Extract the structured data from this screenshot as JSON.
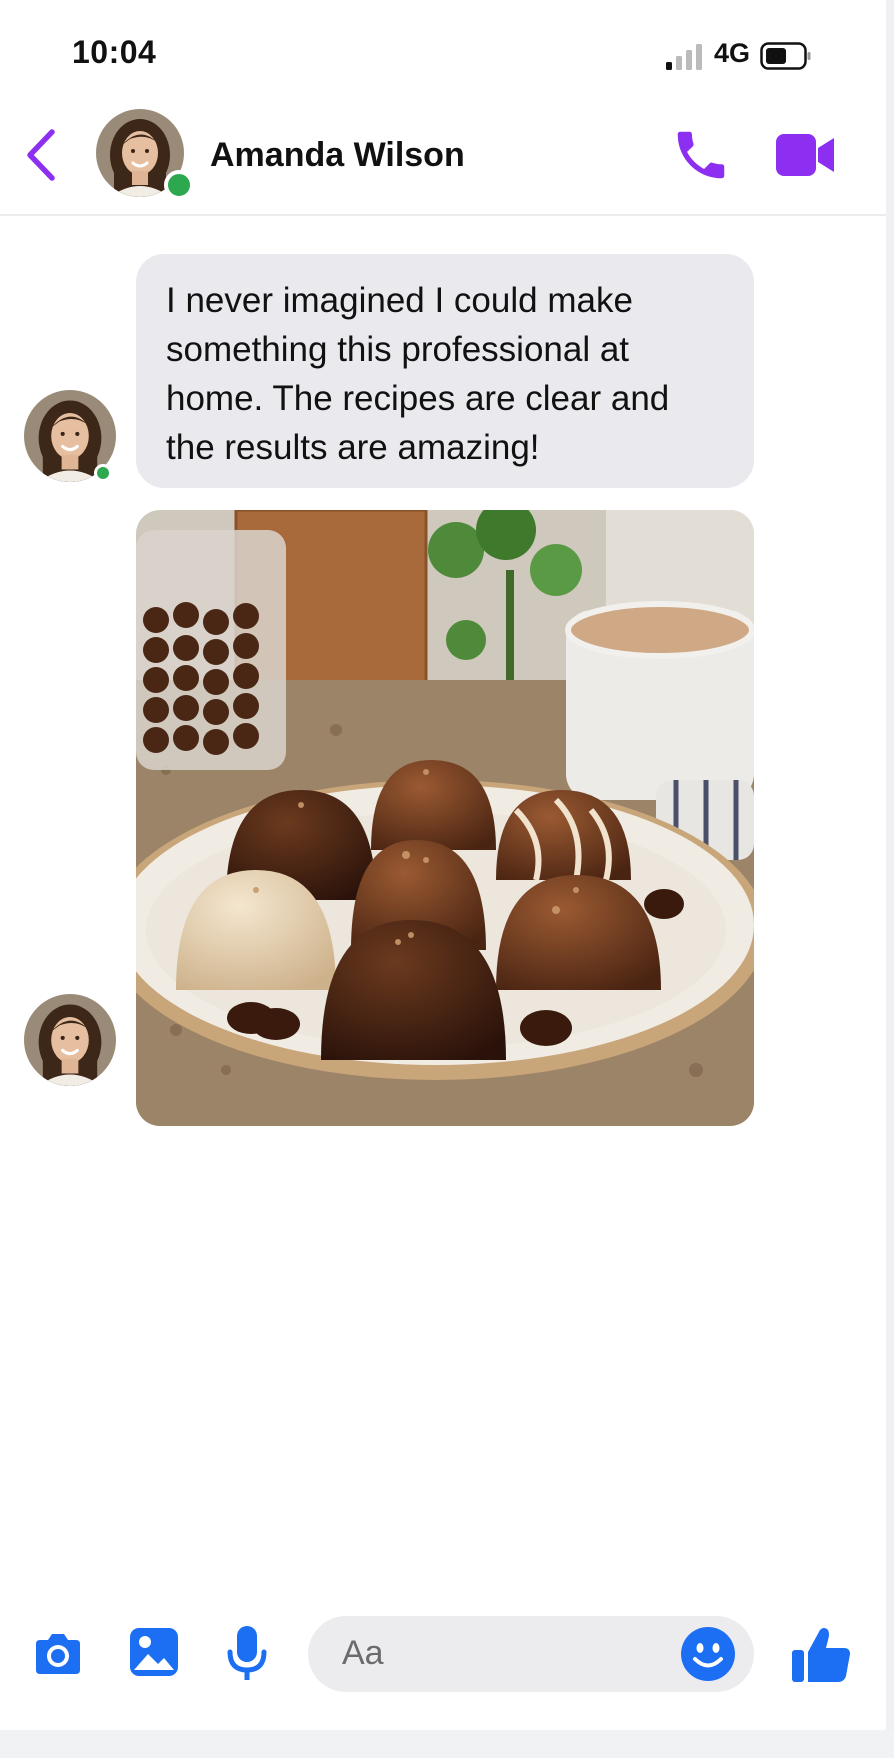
{
  "status_bar": {
    "time": "10:04",
    "network": "4G"
  },
  "header": {
    "contact_name": "Amanda Wilson",
    "icons": [
      "back-chevron-icon",
      "phone-icon",
      "video-camera-icon"
    ],
    "online": true
  },
  "messages": [
    {
      "type": "text",
      "text": "I never imagined I could make something this professional at home. The recipes are clear and the results are amazing!"
    },
    {
      "type": "image",
      "subject": "chocolate-bonbons-photo"
    }
  ],
  "composer": {
    "placeholder": "Aa",
    "icons": [
      "camera-icon",
      "gallery-icon",
      "microphone-icon",
      "emoji-icon",
      "thumbs-up-icon"
    ]
  },
  "colors": {
    "header_accent": "#8c2ff0",
    "composer_accent": "#1c6ef2",
    "online": "#2ea84f",
    "bubble": "#e9e9ee"
  }
}
